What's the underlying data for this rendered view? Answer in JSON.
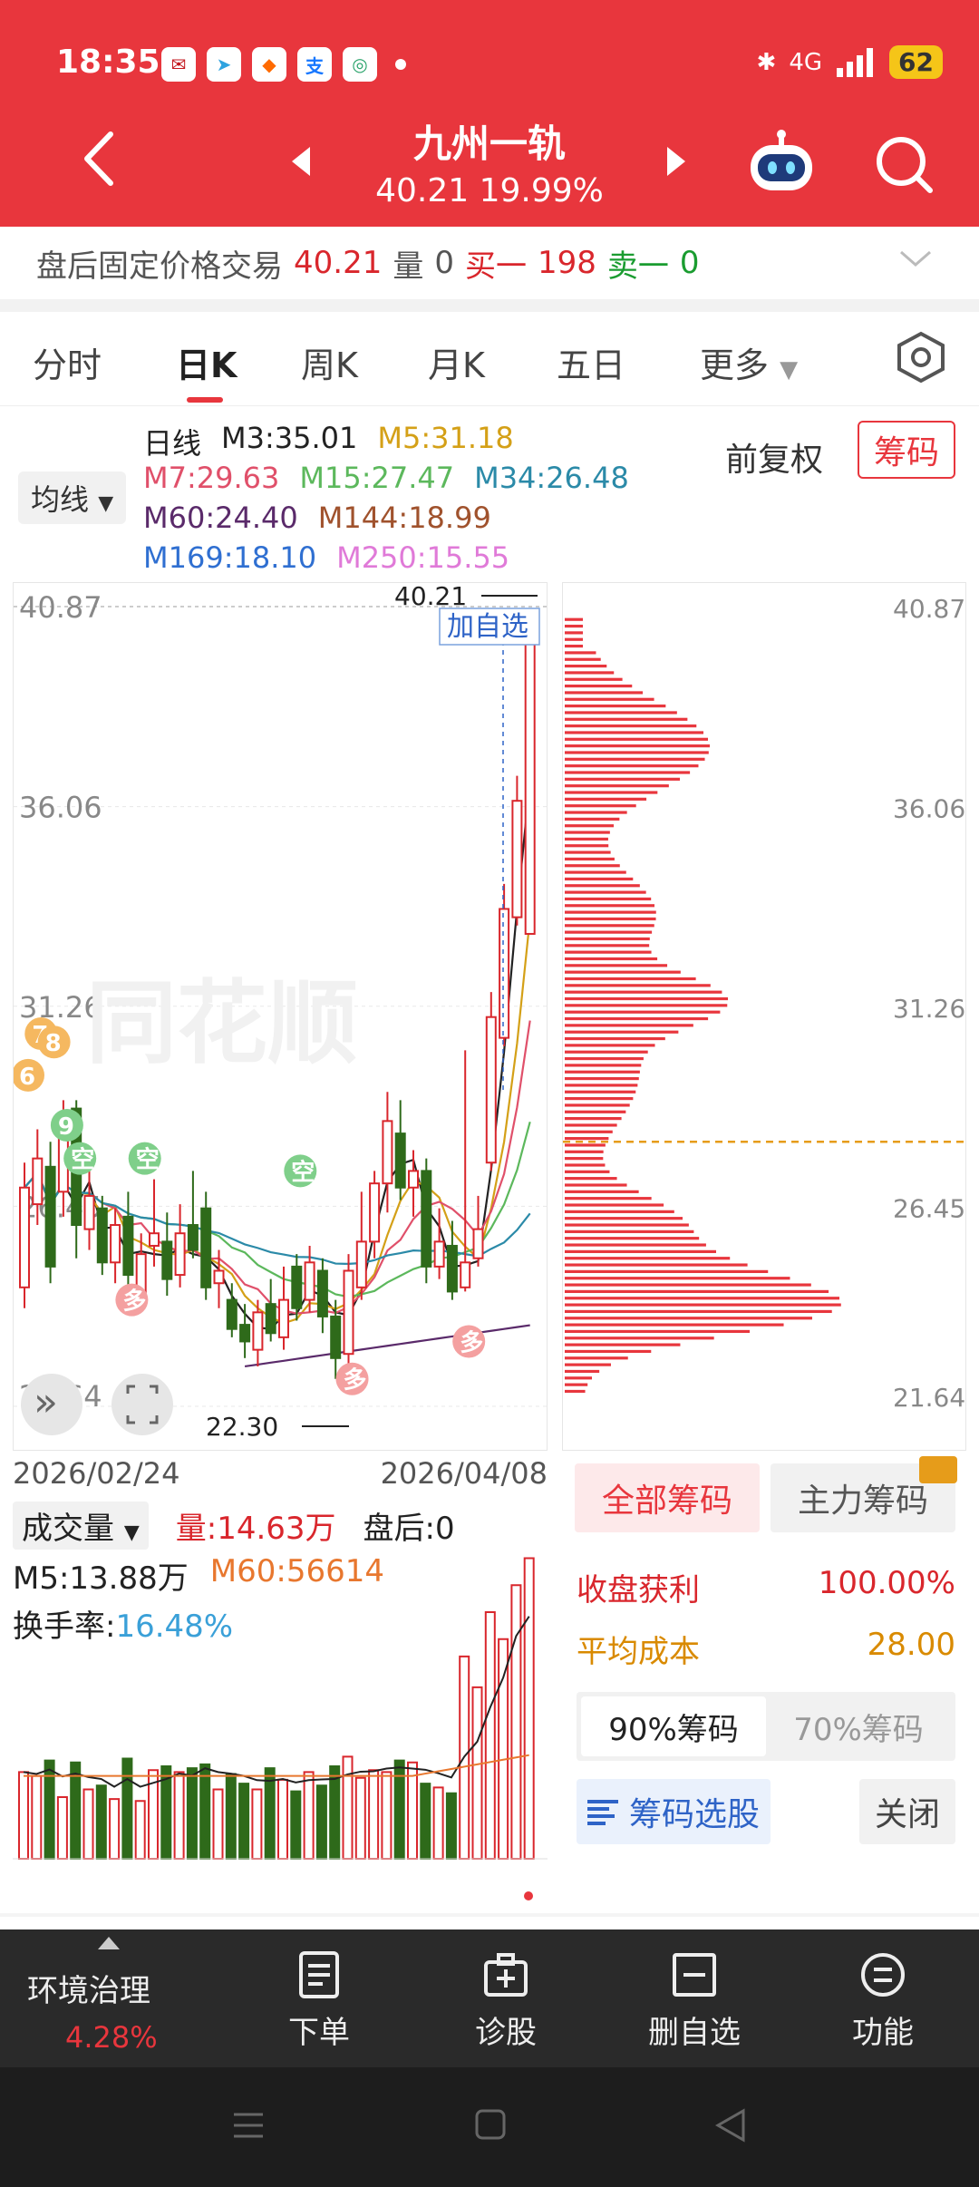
{
  "status": {
    "time": "18:35",
    "network": "4G",
    "battery": "62"
  },
  "header": {
    "stock_name": "九州一轨",
    "price_change": "40.21 19.99%"
  },
  "after_hours": {
    "label": "盘后固定价格交易",
    "price": "40.21",
    "vol_label": "量",
    "vol": "0",
    "buy_label": "买一",
    "buy": "198",
    "sell_label": "卖一",
    "sell": "0"
  },
  "tabs": [
    "分时",
    "日K",
    "周K",
    "月K",
    "五日",
    "更多"
  ],
  "active_tab": "日K",
  "ma": {
    "selector": "均线",
    "title": "日线",
    "rows": [
      [
        {
          "t": "M3:35.01",
          "c": "#222222"
        },
        {
          "t": "M5:31.18",
          "c": "#d4a017"
        }
      ],
      [
        {
          "t": "M7:29.63",
          "c": "#e0506a"
        },
        {
          "t": "M15:27.47",
          "c": "#5cb85c"
        },
        {
          "t": "M34:26.48",
          "c": "#2b8aa8"
        }
      ],
      [
        {
          "t": "M60:24.40",
          "c": "#5a2a6a"
        },
        {
          "t": "M144:18.99",
          "c": "#a0522d"
        }
      ],
      [
        {
          "t": "M169:18.10",
          "c": "#2f6fd1"
        },
        {
          "t": "M250:15.55",
          "c": "#e07ad8"
        }
      ]
    ],
    "adjust": "前复权",
    "chips_btn": "筹码"
  },
  "chart": {
    "y_labels": [
      "40.87",
      "36.06",
      "31.26",
      "26.45",
      "21.64"
    ],
    "price_tag": "40.21",
    "low_tag": "22.30",
    "add_fav": "加自选",
    "watermark": "同花顺",
    "date_start": "2026/02/24",
    "date_end": "2026/04/08",
    "markers": [
      "7",
      "8",
      "6",
      "9",
      "空",
      "空",
      "空",
      "多",
      "多",
      "多"
    ]
  },
  "chart_data": {
    "type": "candlestick",
    "ylim": [
      21.64,
      40.87
    ],
    "candles": [
      {
        "o": 24.5,
        "c": 26.9,
        "h": 27.5,
        "l": 24.0
      },
      {
        "o": 26.5,
        "c": 27.6,
        "h": 28.3,
        "l": 26.0
      },
      {
        "o": 27.4,
        "c": 25.0,
        "h": 28.0,
        "l": 24.6
      },
      {
        "o": 26.8,
        "c": 28.4,
        "h": 29.0,
        "l": 26.2
      },
      {
        "o": 28.8,
        "c": 26.0,
        "h": 29.0,
        "l": 25.2
      },
      {
        "o": 25.9,
        "c": 26.7,
        "h": 27.3,
        "l": 25.4
      },
      {
        "o": 26.4,
        "c": 25.1,
        "h": 26.7,
        "l": 24.8
      },
      {
        "o": 25.1,
        "c": 26.0,
        "h": 26.4,
        "l": 24.6
      },
      {
        "o": 26.2,
        "c": 24.8,
        "h": 26.8,
        "l": 24.3
      },
      {
        "o": 24.3,
        "c": 25.3,
        "h": 25.8,
        "l": 23.9
      },
      {
        "o": 25.5,
        "c": 25.8,
        "h": 27.1,
        "l": 25.0
      },
      {
        "o": 25.6,
        "c": 24.7,
        "h": 26.3,
        "l": 24.3
      },
      {
        "o": 24.8,
        "c": 25.8,
        "h": 26.5,
        "l": 24.5
      },
      {
        "o": 26.0,
        "c": 25.4,
        "h": 27.3,
        "l": 25.2
      },
      {
        "o": 26.4,
        "c": 24.5,
        "h": 26.8,
        "l": 24.2
      },
      {
        "o": 24.6,
        "c": 24.9,
        "h": 25.4,
        "l": 24.0
      },
      {
        "o": 24.2,
        "c": 23.5,
        "h": 24.6,
        "l": 23.3
      },
      {
        "o": 23.6,
        "c": 23.2,
        "h": 24.1,
        "l": 22.8
      },
      {
        "o": 23.0,
        "c": 23.9,
        "h": 24.2,
        "l": 22.6
      },
      {
        "o": 24.1,
        "c": 23.4,
        "h": 24.7,
        "l": 23.2
      },
      {
        "o": 23.3,
        "c": 24.2,
        "h": 25.0,
        "l": 23.0
      },
      {
        "o": 25.0,
        "c": 24.0,
        "h": 25.3,
        "l": 23.7
      },
      {
        "o": 24.2,
        "c": 25.1,
        "h": 25.5,
        "l": 23.9
      },
      {
        "o": 24.9,
        "c": 23.8,
        "h": 25.2,
        "l": 23.4
      },
      {
        "o": 23.8,
        "c": 22.8,
        "h": 24.2,
        "l": 22.3
      },
      {
        "o": 22.9,
        "c": 24.9,
        "h": 25.3,
        "l": 22.6
      },
      {
        "o": 24.5,
        "c": 25.6,
        "h": 26.8,
        "l": 24.2
      },
      {
        "o": 25.6,
        "c": 27.0,
        "h": 27.3,
        "l": 25.2
      },
      {
        "o": 27.0,
        "c": 28.5,
        "h": 29.2,
        "l": 26.3
      },
      {
        "o": 28.2,
        "c": 26.9,
        "h": 29.0,
        "l": 26.6
      },
      {
        "o": 26.9,
        "c": 27.3,
        "h": 27.8,
        "l": 26.2
      },
      {
        "o": 27.3,
        "c": 25.0,
        "h": 27.6,
        "l": 24.6
      },
      {
        "o": 25.0,
        "c": 25.6,
        "h": 26.4,
        "l": 24.7
      },
      {
        "o": 25.5,
        "c": 24.4,
        "h": 26.1,
        "l": 24.2
      },
      {
        "o": 24.5,
        "c": 25.1,
        "h": 30.2,
        "l": 24.4
      },
      {
        "o": 25.2,
        "c": 25.9,
        "h": 26.7,
        "l": 25.0
      },
      {
        "o": 27.5,
        "c": 31.0,
        "h": 31.6,
        "l": 27.3
      },
      {
        "o": 30.5,
        "c": 33.6,
        "h": 34.2,
        "l": 30.3
      },
      {
        "o": 33.4,
        "c": 36.2,
        "h": 36.8,
        "l": 33.2
      },
      {
        "o": 33.0,
        "c": 40.21,
        "h": 40.21,
        "l": 33.0
      }
    ],
    "volume": {
      "legend_label": "成交量",
      "vol_label": "量:14.63万",
      "after_label": "盘后:0",
      "m5_label": "M5:13.88万",
      "m60_label": "M60:56614",
      "turnover_label": "换手率:",
      "turnover": "16.48%",
      "values": [
        4.5,
        4.3,
        5.1,
        3.2,
        5.0,
        3.6,
        3.8,
        3.1,
        5.2,
        3.0,
        4.6,
        4.8,
        4.5,
        4.7,
        4.9,
        3.6,
        4.4,
        3.9,
        3.6,
        4.7,
        4.1,
        3.5,
        4.5,
        3.8,
        4.8,
        5.3,
        4.2,
        4.6,
        4.5,
        5.1,
        5.0,
        3.9,
        3.7,
        3.4,
        10.5,
        8.9,
        12.8,
        11.4,
        14.2,
        15.6
      ]
    },
    "chip_distribution": {
      "y_labels": [
        "40.87",
        "36.06",
        "31.26",
        "26.45",
        "21.64"
      ],
      "avg_cost_line": 28.0
    }
  },
  "chip_panel": {
    "tab_all": "全部筹码",
    "tab_main": "主力筹码",
    "profit_label": "收盘获利",
    "profit": "100.00%",
    "cost_label": "平均成本",
    "cost": "28.00",
    "pct90": "90%筹码",
    "pct70": "70%筹码",
    "select_btn": "筹码选股",
    "close_btn": "关闭"
  },
  "bottom": {
    "env_name": "环境治理",
    "env_pct": "4.28%",
    "items": [
      "下单",
      "诊股",
      "删自选",
      "功能"
    ]
  },
  "colors": {
    "brand_red": "#e8363d",
    "up_red": "#d9262c",
    "down_green": "#2e6a1a"
  }
}
